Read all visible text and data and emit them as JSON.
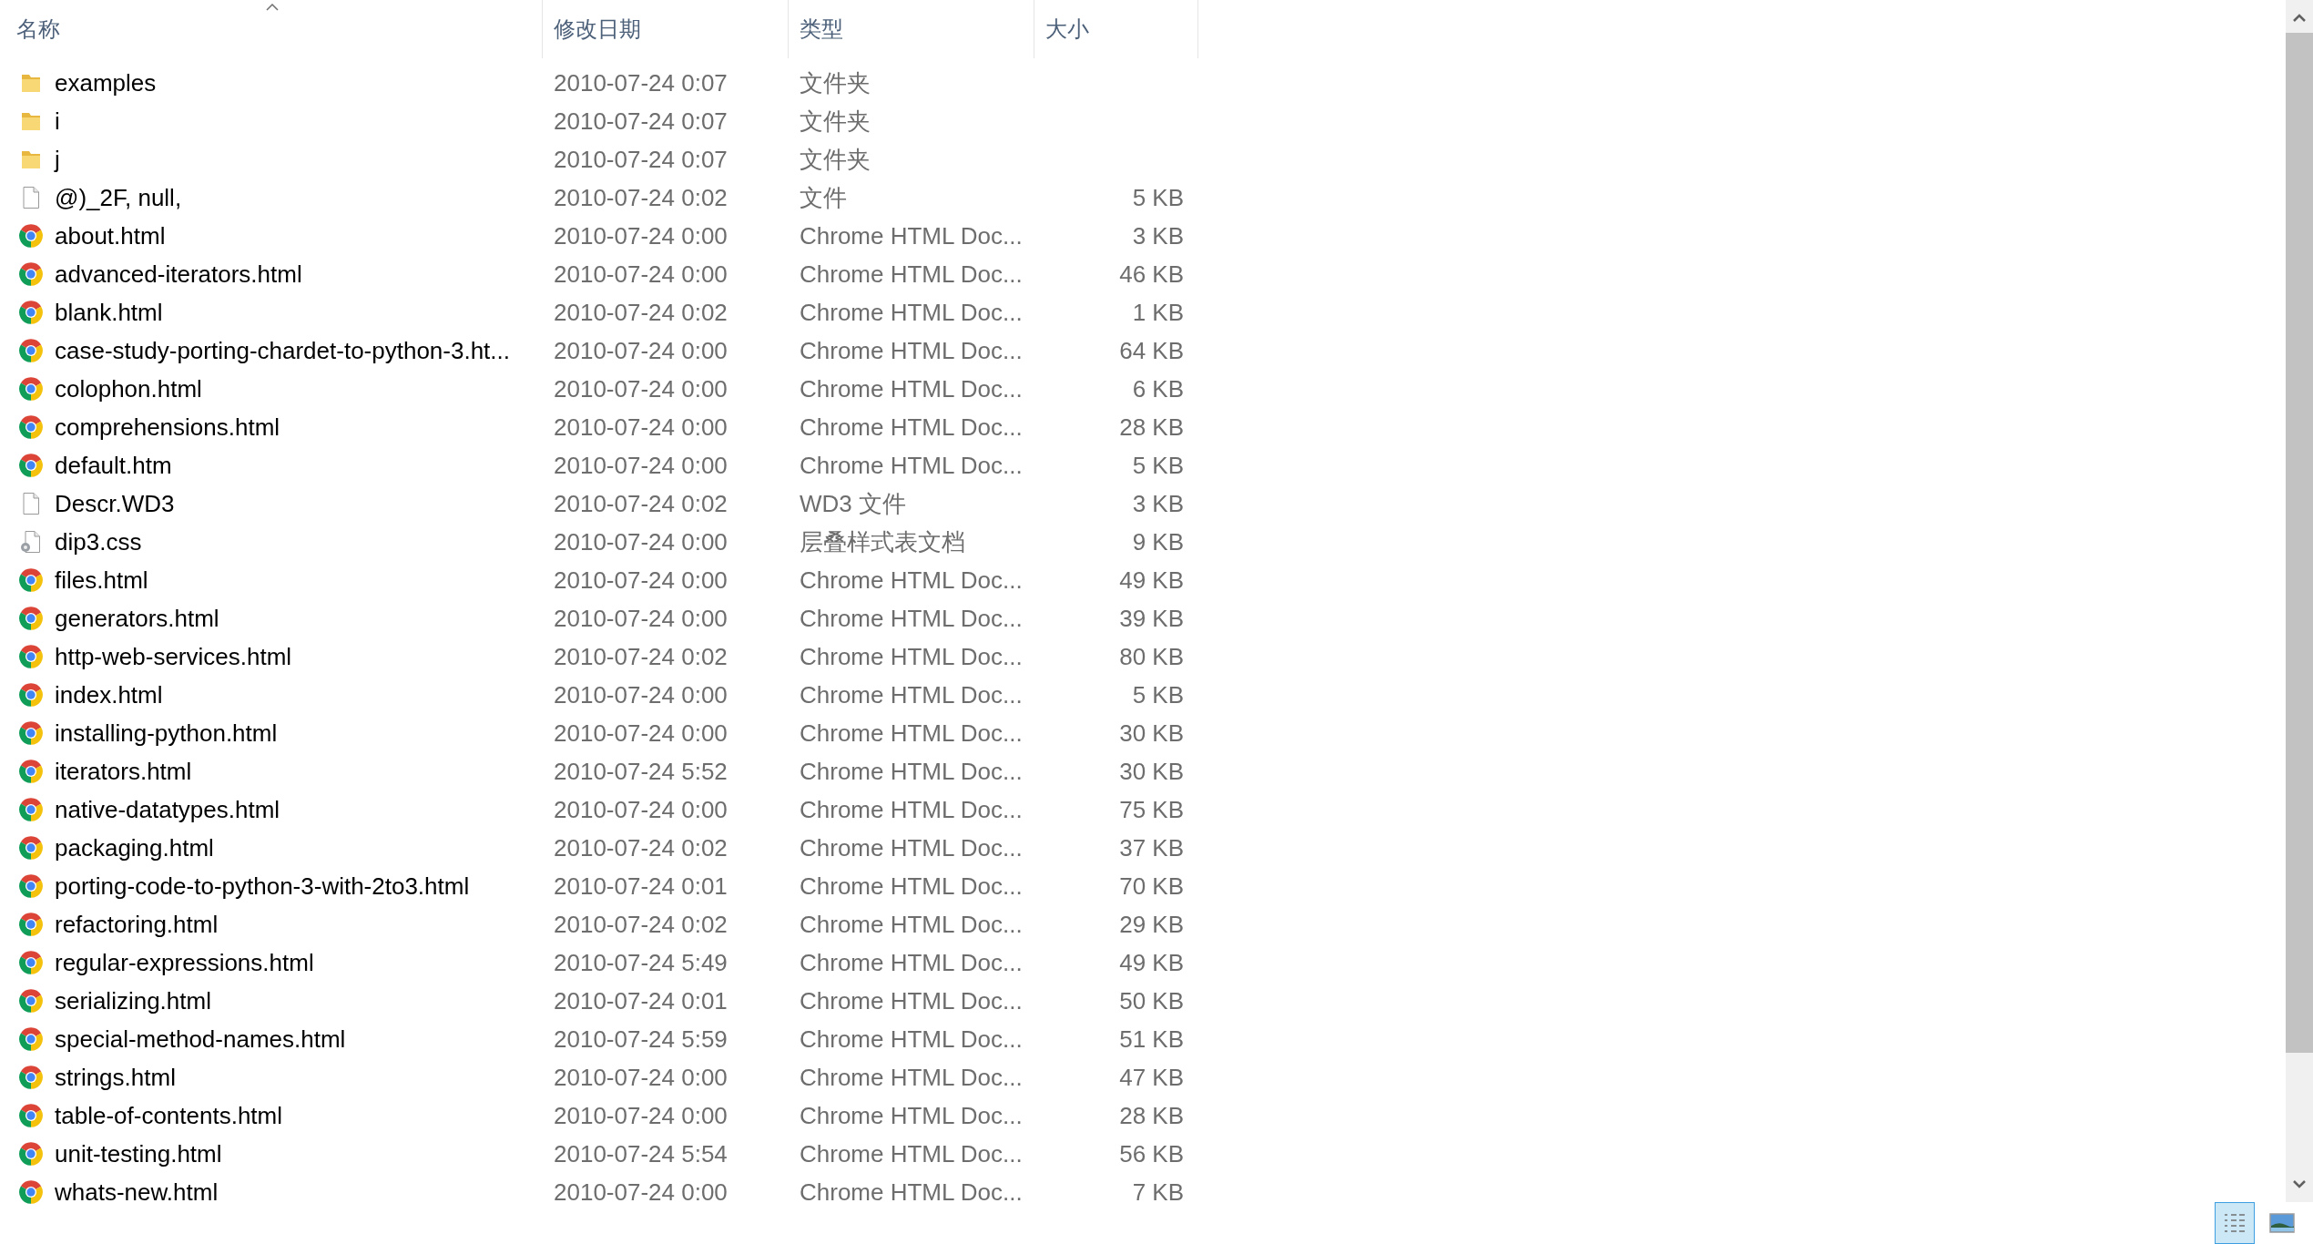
{
  "columns": [
    {
      "label": "名称",
      "sorted": true
    },
    {
      "label": "修改日期",
      "sorted": false
    },
    {
      "label": "类型",
      "sorted": false
    },
    {
      "label": "大小",
      "sorted": false
    }
  ],
  "rows": [
    {
      "kind": "folder",
      "name": "examples",
      "date": "2010-07-24 0:07",
      "type": "文件夹"
    },
    {
      "kind": "folder",
      "name": "i",
      "date": "2010-07-24 0:07",
      "type": "文件夹"
    },
    {
      "kind": "folder",
      "name": "j",
      "date": "2010-07-24 0:07",
      "type": "文件夹"
    },
    {
      "kind": "file",
      "name": "@)_2F, null,",
      "date": "2010-07-24 0:02",
      "type": "文件",
      "size": "5 KB"
    },
    {
      "kind": "chrome",
      "name": "about.html",
      "date": "2010-07-24 0:00",
      "type": "Chrome HTML Doc...",
      "size": "3 KB"
    },
    {
      "kind": "chrome",
      "name": "advanced-iterators.html",
      "date": "2010-07-24 0:00",
      "type": "Chrome HTML Doc...",
      "size": "46 KB"
    },
    {
      "kind": "chrome",
      "name": "blank.html",
      "date": "2010-07-24 0:02",
      "type": "Chrome HTML Doc...",
      "size": "1 KB"
    },
    {
      "kind": "chrome",
      "name": "case-study-porting-chardet-to-python-3.ht...",
      "date": "2010-07-24 0:00",
      "type": "Chrome HTML Doc...",
      "size": "64 KB"
    },
    {
      "kind": "chrome",
      "name": "colophon.html",
      "date": "2010-07-24 0:00",
      "type": "Chrome HTML Doc...",
      "size": "6 KB"
    },
    {
      "kind": "chrome",
      "name": "comprehensions.html",
      "date": "2010-07-24 0:00",
      "type": "Chrome HTML Doc...",
      "size": "28 KB"
    },
    {
      "kind": "chrome",
      "name": "default.htm",
      "date": "2010-07-24 0:00",
      "type": "Chrome HTML Doc...",
      "size": "5 KB"
    },
    {
      "kind": "file",
      "name": "Descr.WD3",
      "date": "2010-07-24 0:02",
      "type": "WD3 文件",
      "size": "3 KB"
    },
    {
      "kind": "css",
      "name": "dip3.css",
      "date": "2010-07-24 0:00",
      "type": "层叠样式表文档",
      "size": "9 KB"
    },
    {
      "kind": "chrome",
      "name": "files.html",
      "date": "2010-07-24 0:00",
      "type": "Chrome HTML Doc...",
      "size": "49 KB"
    },
    {
      "kind": "chrome",
      "name": "generators.html",
      "date": "2010-07-24 0:00",
      "type": "Chrome HTML Doc...",
      "size": "39 KB"
    },
    {
      "kind": "chrome",
      "name": "http-web-services.html",
      "date": "2010-07-24 0:02",
      "type": "Chrome HTML Doc...",
      "size": "80 KB"
    },
    {
      "kind": "chrome",
      "name": "index.html",
      "date": "2010-07-24 0:00",
      "type": "Chrome HTML Doc...",
      "size": "5 KB"
    },
    {
      "kind": "chrome",
      "name": "installing-python.html",
      "date": "2010-07-24 0:00",
      "type": "Chrome HTML Doc...",
      "size": "30 KB"
    },
    {
      "kind": "chrome",
      "name": "iterators.html",
      "date": "2010-07-24 5:52",
      "type": "Chrome HTML Doc...",
      "size": "30 KB"
    },
    {
      "kind": "chrome",
      "name": "native-datatypes.html",
      "date": "2010-07-24 0:00",
      "type": "Chrome HTML Doc...",
      "size": "75 KB"
    },
    {
      "kind": "chrome",
      "name": "packaging.html",
      "date": "2010-07-24 0:02",
      "type": "Chrome HTML Doc...",
      "size": "37 KB"
    },
    {
      "kind": "chrome",
      "name": "porting-code-to-python-3-with-2to3.html",
      "date": "2010-07-24 0:01",
      "type": "Chrome HTML Doc...",
      "size": "70 KB"
    },
    {
      "kind": "chrome",
      "name": "refactoring.html",
      "date": "2010-07-24 0:02",
      "type": "Chrome HTML Doc...",
      "size": "29 KB"
    },
    {
      "kind": "chrome",
      "name": "regular-expressions.html",
      "date": "2010-07-24 5:49",
      "type": "Chrome HTML Doc...",
      "size": "49 KB"
    },
    {
      "kind": "chrome",
      "name": "serializing.html",
      "date": "2010-07-24 0:01",
      "type": "Chrome HTML Doc...",
      "size": "50 KB"
    },
    {
      "kind": "chrome",
      "name": "special-method-names.html",
      "date": "2010-07-24 5:59",
      "type": "Chrome HTML Doc...",
      "size": "51 KB"
    },
    {
      "kind": "chrome",
      "name": "strings.html",
      "date": "2010-07-24 0:00",
      "type": "Chrome HTML Doc...",
      "size": "47 KB"
    },
    {
      "kind": "chrome",
      "name": "table-of-contents.html",
      "date": "2010-07-24 0:00",
      "type": "Chrome HTML Doc...",
      "size": "28 KB"
    },
    {
      "kind": "chrome",
      "name": "unit-testing.html",
      "date": "2010-07-24 5:54",
      "type": "Chrome HTML Doc...",
      "size": "56 KB"
    },
    {
      "kind": "chrome",
      "name": "whats-new.html",
      "date": "2010-07-24 0:00",
      "type": "Chrome HTML Doc...",
      "size": "7 KB"
    }
  ],
  "view_buttons": [
    {
      "kind": "details",
      "selected": true
    },
    {
      "kind": "large-icons",
      "selected": false
    }
  ]
}
